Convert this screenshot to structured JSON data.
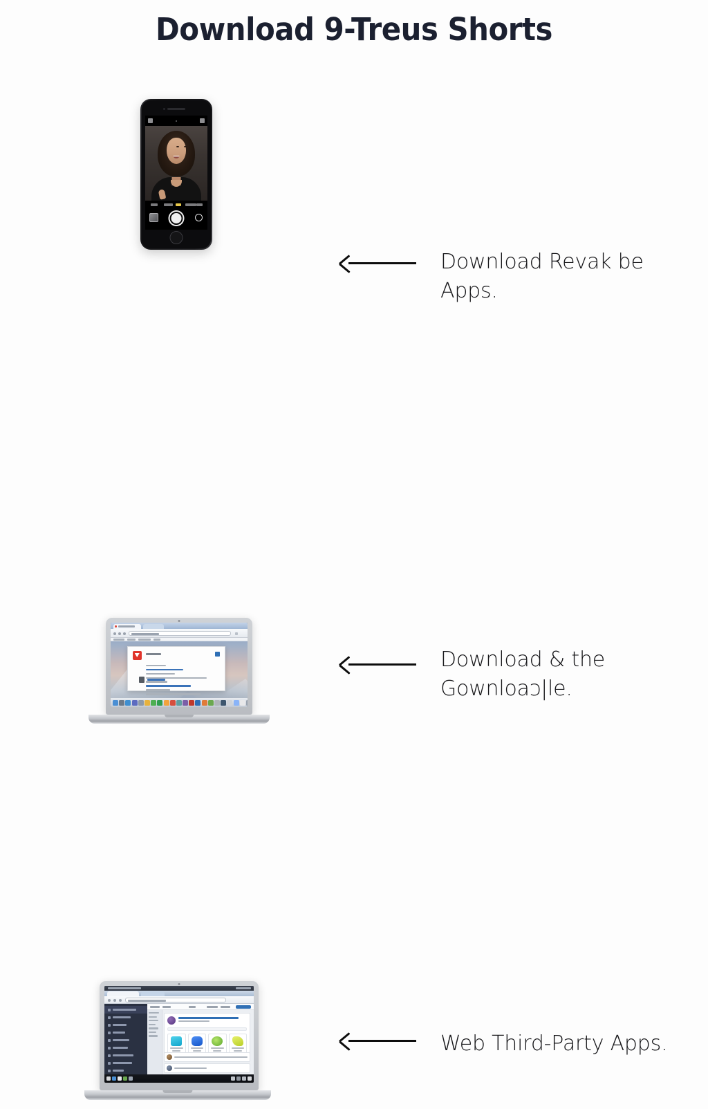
{
  "page": {
    "title": "Download 9-Treus Shorts",
    "background_color": "#fdfdfd",
    "title_color": "#1b2030",
    "arrow_color": "#0d0d0d",
    "callout_color": "#17171a"
  },
  "rows": [
    {
      "visual": "smartphone-camera-app",
      "arrow": "left-arrow",
      "callout_line1": "Download  Revak be",
      "callout_line2": "Apps."
    },
    {
      "visual": "laptop-browser-download-dialog",
      "arrow": "left-arrow",
      "callout_line1": "Download & the",
      "callout_line2": "Gownloaɔ|le."
    },
    {
      "visual": "laptop-browser-third-party-app",
      "arrow": "left-arrow",
      "callout_line1": "Web Third-Party Apps.",
      "callout_line2": ""
    }
  ],
  "phone": {
    "camera_modes": [
      "",
      "",
      "",
      "",
      ""
    ],
    "shutter": "shutter-button",
    "thumbnail": "last-photo-thumbnail",
    "flip": "flip-camera-button",
    "home": "home-button"
  },
  "laptop_dialog": {
    "app_icon_color": "#e0342b",
    "dock_icon_colors": [
      "#4a8fd4",
      "#6c7a89",
      "#3f8fd0",
      "#5c6bc0",
      "#8e9aa8",
      "#e8b23c",
      "#4caf50",
      "#2f9e4f",
      "#f2a33c",
      "#d64f3e",
      "#5f9ea0",
      "#7b5ea7",
      "#c0392b",
      "#2f6fb5",
      "#e07b39",
      "#6aa84f",
      "#b0b5bb",
      "#3d566e",
      "#cfd3d8",
      "#8ab4f8",
      "#e8e8ea",
      "#9aa3af"
    ]
  },
  "laptop_app": {
    "sidebar_rows": 8,
    "tile_colors": [
      "#29b6d8",
      "#1d6fd8",
      "#7cc243",
      "#cddc39"
    ],
    "avatar_color": "#6c4a95",
    "link_color": "#2f6fb5",
    "taskbar_icon_colors": [
      "#d6d8db",
      "#4a8fd4",
      "#e8e8ea",
      "#6aa84f",
      "#9aa3af",
      "#3d566e",
      "#c0392b",
      "#e8b23c"
    ]
  }
}
